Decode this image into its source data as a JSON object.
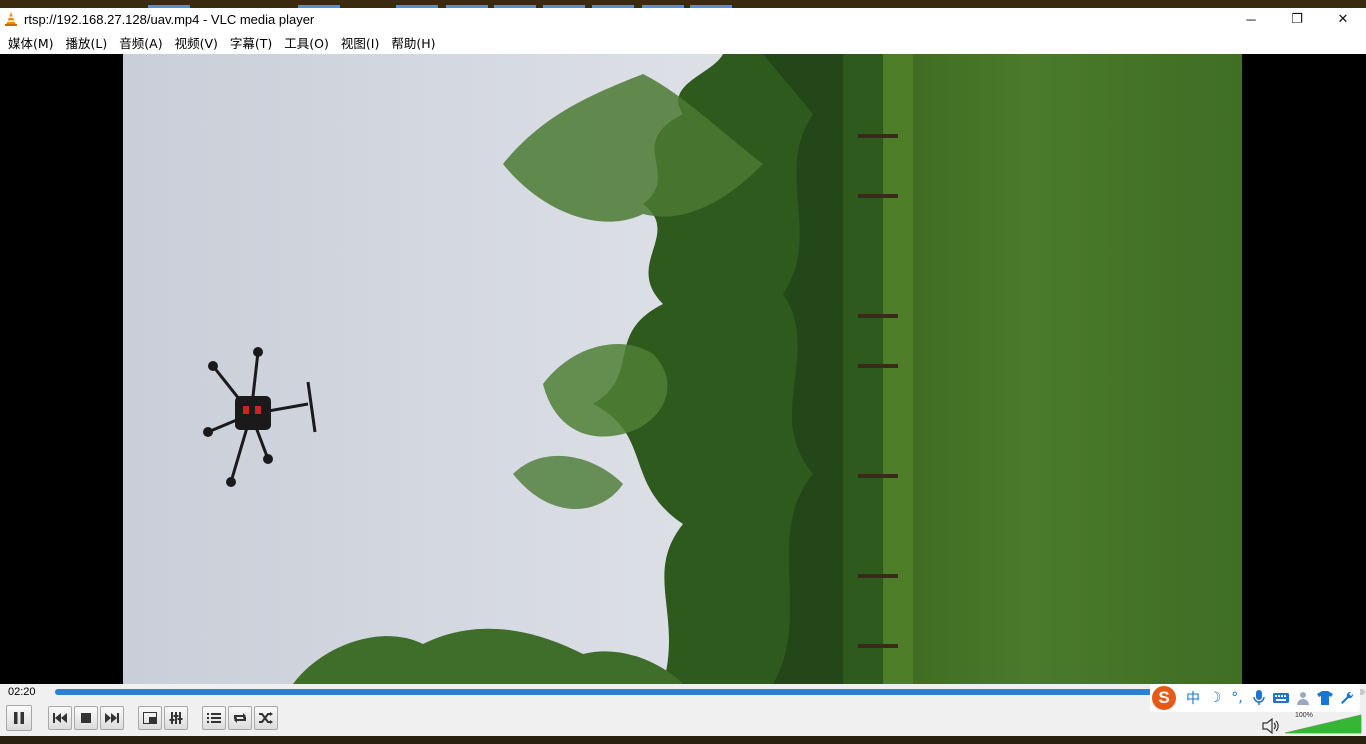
{
  "window": {
    "title": "rtsp://192.168.27.128/uav.mp4 - VLC media player",
    "minimize_glyph": "─",
    "restore_glyph": "❐",
    "close_glyph": "✕"
  },
  "menu": {
    "items": [
      {
        "label": "媒体(M)",
        "name": "menu-media"
      },
      {
        "label": "播放(L)",
        "name": "menu-playback"
      },
      {
        "label": "音频(A)",
        "name": "menu-audio"
      },
      {
        "label": "视频(V)",
        "name": "menu-video"
      },
      {
        "label": "字幕(T)",
        "name": "menu-subtitle"
      },
      {
        "label": "工具(O)",
        "name": "menu-tools"
      },
      {
        "label": "视图(I)",
        "name": "menu-view"
      },
      {
        "label": "帮助(H)",
        "name": "menu-help"
      }
    ]
  },
  "player": {
    "elapsed_time": "02:20",
    "progress_fraction": 0.86,
    "volume_label": "100%",
    "volume_fraction": 1.0
  },
  "ime": {
    "logo": "S",
    "lang": "中",
    "mode_glyph": "☽",
    "punct_glyph": "°,",
    "items": [
      "mic-icon",
      "keyboard-icon",
      "person-icon",
      "shirt-icon",
      "wrench-icon"
    ]
  },
  "colors": {
    "seek_fill": "#2d7fd4",
    "vlc_orange": "#f08a00",
    "ime_blue": "#1a76d2",
    "volume_green": "#35b635"
  }
}
